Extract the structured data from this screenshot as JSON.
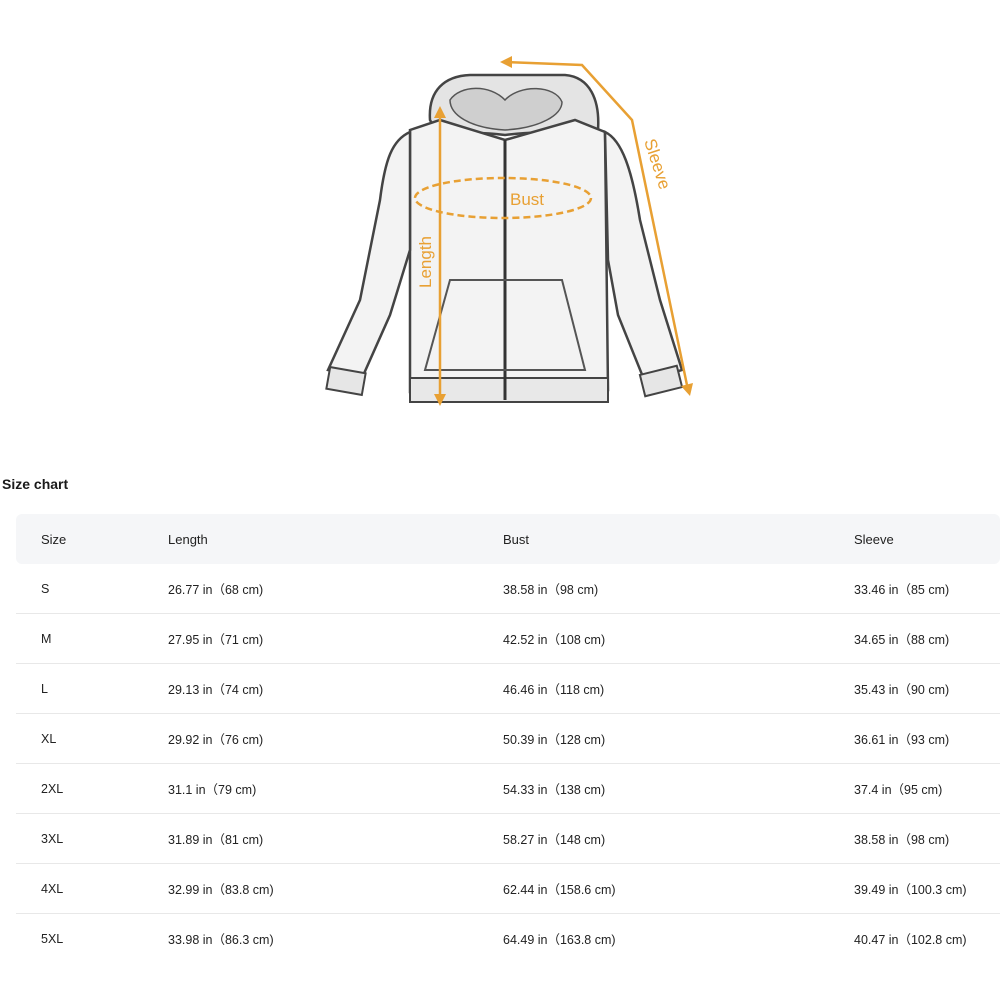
{
  "diagram": {
    "labels": {
      "bust": "Bust",
      "length": "Length",
      "sleeve": "Sleeve"
    },
    "accent_color": "#e8a033",
    "garment": "zip-up hoodie"
  },
  "size_chart": {
    "title": "Size chart",
    "headers": [
      "Size",
      "Length",
      "Bust",
      "Sleeve"
    ],
    "rows": [
      [
        "S",
        "26.77 in（68 cm)",
        "38.58 in（98 cm)",
        "33.46 in（85 cm)"
      ],
      [
        "M",
        "27.95 in（71 cm)",
        "42.52 in（108 cm)",
        "34.65 in（88 cm)"
      ],
      [
        "L",
        "29.13 in（74 cm)",
        "46.46 in（118 cm)",
        "35.43 in（90 cm)"
      ],
      [
        "XL",
        "29.92 in（76 cm)",
        "50.39 in（128 cm)",
        "36.61 in（93 cm)"
      ],
      [
        "2XL",
        "31.1 in（79 cm)",
        "54.33 in（138 cm)",
        "37.4 in（95 cm)"
      ],
      [
        "3XL",
        "31.89 in（81 cm)",
        "58.27 in（148 cm)",
        "38.58 in（98 cm)"
      ],
      [
        "4XL",
        "32.99 in（83.8 cm)",
        "62.44 in（158.6 cm)",
        "39.49 in（100.3 cm)"
      ],
      [
        "5XL",
        "33.98 in（86.3 cm)",
        "64.49 in（163.8 cm)",
        "40.47 in（102.8 cm)"
      ]
    ]
  }
}
